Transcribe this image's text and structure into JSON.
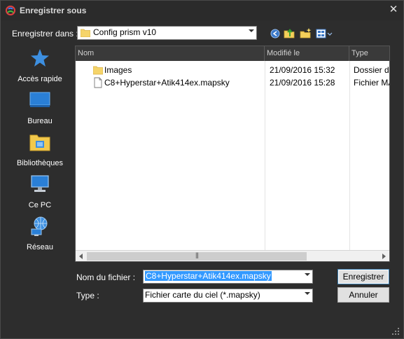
{
  "window": {
    "title": "Enregistrer sous",
    "close_label": "✕"
  },
  "location": {
    "label": "Enregistrer dans :",
    "value": "Config prism v10"
  },
  "toolbar": [
    "back-icon",
    "up-folder-icon",
    "new-folder-icon",
    "view-menu-icon"
  ],
  "places": [
    {
      "label": "Accès rapide",
      "icon": "star-icon"
    },
    {
      "label": "Bureau",
      "icon": "desktop-icon"
    },
    {
      "label": "Bibliothèques",
      "icon": "library-icon"
    },
    {
      "label": "Ce PC",
      "icon": "computer-icon"
    },
    {
      "label": "Réseau",
      "icon": "network-icon"
    }
  ],
  "filelist": {
    "columns": [
      "Nom",
      "Modifié le",
      "Type"
    ],
    "rows": [
      {
        "name": "Images",
        "modified": "21/09/2016 15:32",
        "type": "Dossier de",
        "icon": "folder-icon"
      },
      {
        "name": "C8+Hyperstar+Atik414ex.mapsky",
        "modified": "21/09/2016 15:28",
        "type": "Fichier MA",
        "icon": "file-icon"
      }
    ],
    "scroll_grip": "|||"
  },
  "filename": {
    "label": "Nom du fichier :",
    "value": "C8+Hyperstar+Atik414ex.mapsky"
  },
  "filetype": {
    "label": "Type :",
    "value": "Fichier carte du ciel (*.mapsky)"
  },
  "buttons": {
    "save": "Enregistrer",
    "cancel": "Annuler"
  },
  "colors": {
    "background": "#2d2d2d",
    "selection": "#3399ff",
    "header": "#3a3a3a"
  }
}
